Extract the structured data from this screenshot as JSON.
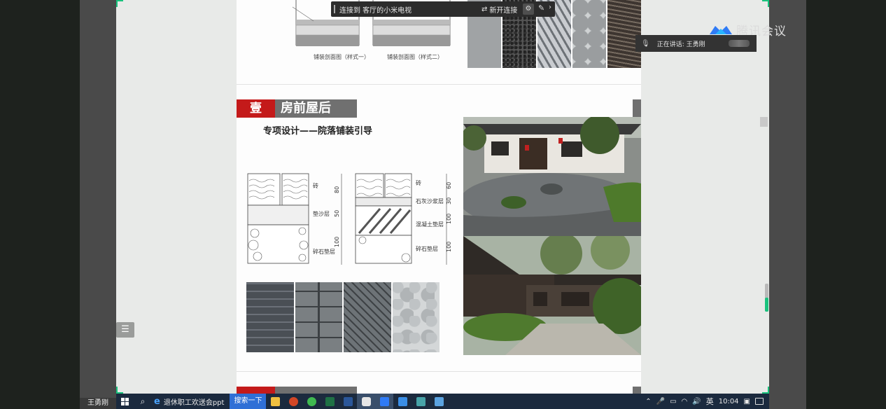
{
  "cast_bar": {
    "text": "连接到 客厅的小米电视",
    "new_connection": "新开连接"
  },
  "brand": {
    "name": "腾讯会议"
  },
  "speaking": {
    "label": "正在讲话: 王勇刚"
  },
  "user_tag": "王勇刚",
  "slide": {
    "diagram_top": {
      "caption1": "铺装剖面图（样式一）",
      "caption2": "铺装剖面图（样式二）"
    },
    "section_number": "壹",
    "section_title": "房前屋后",
    "subtitle": "专项设计——院落铺装引导",
    "diagram": {
      "layer_brick": "砖",
      "layer_sand": "垫沙层",
      "layer_gravel": "碎石垫层",
      "layer_brick2": "砖",
      "layer_lime": "石灰沙浆层",
      "layer_concrete": "混凝土垫层",
      "layer_gravel2": "碎石垫层",
      "dim1": "80",
      "dim2": "50",
      "dim3": "100",
      "dim4": "60",
      "dim5": "30",
      "dim6": "100",
      "dim7": "100"
    }
  },
  "taskbar": {
    "ie_title": "退休职工欢送会ppt",
    "baidu": "搜索一下",
    "ime": "英",
    "time": "10:04"
  },
  "colors": {
    "accent_green": "#19c37d",
    "section_red": "#c41a1a",
    "section_grey": "#707070",
    "taskbar": "#1b2a3e"
  },
  "icons": [
    "start-icon",
    "search-icon",
    "ie-icon",
    "folder-icon",
    "powerpoint-icon",
    "wechat-icon",
    "excel-icon",
    "word-icon",
    "tencent-meeting-icon",
    "mic-icon",
    "settings-icon",
    "pin-icon",
    "list-icon"
  ]
}
